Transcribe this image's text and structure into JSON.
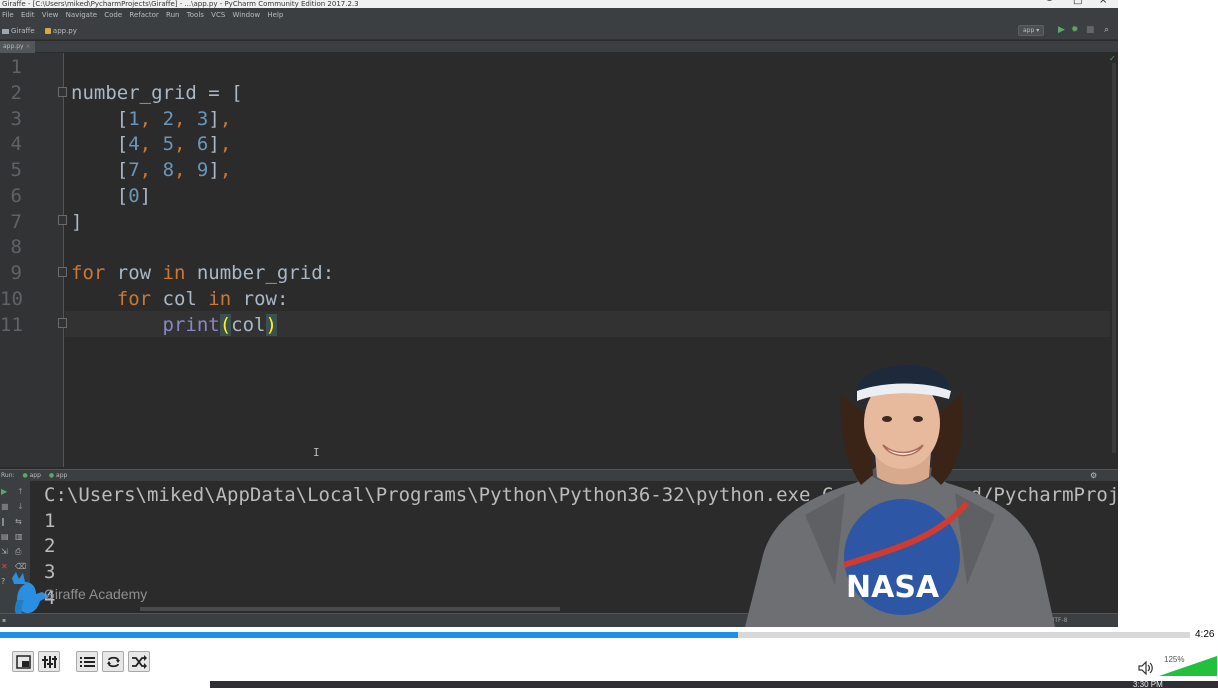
{
  "ide": {
    "window_title": "Giraffe - [C:\\Users\\miked\\PycharmProjects\\Giraffe] - ...\\app.py - PyCharm Community Edition 2017.2.3",
    "menu": [
      "File",
      "Edit",
      "View",
      "Navigate",
      "Code",
      "Refactor",
      "Run",
      "Tools",
      "VCS",
      "Window",
      "Help"
    ],
    "breadcrumb": [
      "Giraffe",
      "app.py"
    ],
    "run_config": "app",
    "tab": "app.py",
    "line_numbers": [
      "1",
      "2",
      "3",
      "4",
      "5",
      "6",
      "7",
      "8",
      "9",
      "10",
      "11"
    ],
    "code_lines": [
      "",
      "number_grid = [",
      "    [1, 2, 3],",
      "    [4, 5, 6],",
      "    [7, 8, 9],",
      "    [0]",
      "]",
      "",
      "for row in number_grid:",
      "    for col in row:",
      "        print(col)"
    ],
    "run_panel": {
      "label": "Run:",
      "tabs": [
        "app",
        "app"
      ],
      "output": [
        "C:\\Users\\miked\\AppData\\Local\\Programs\\Python\\Python36-32\\python.exe C:/Users/miked/PycharmProjects/Giraffe/app.py",
        "1",
        "2",
        "3",
        "4"
      ]
    },
    "status": {
      "encoding": "UTF-8"
    }
  },
  "watermark": "Giraffe Academy",
  "player": {
    "time": "4:26",
    "progress": 0.62,
    "volume_pct": "125%",
    "volume_level": 1.0
  },
  "taskbar": {
    "clock": "3:30 PM"
  },
  "colors": {
    "editor_bg": "#2b2b2b",
    "keyword": "#cc7832",
    "number": "#6897bb",
    "builtin": "#8888c6",
    "seek_fill": "#1e90e6",
    "volume_green": "#21c13d"
  }
}
